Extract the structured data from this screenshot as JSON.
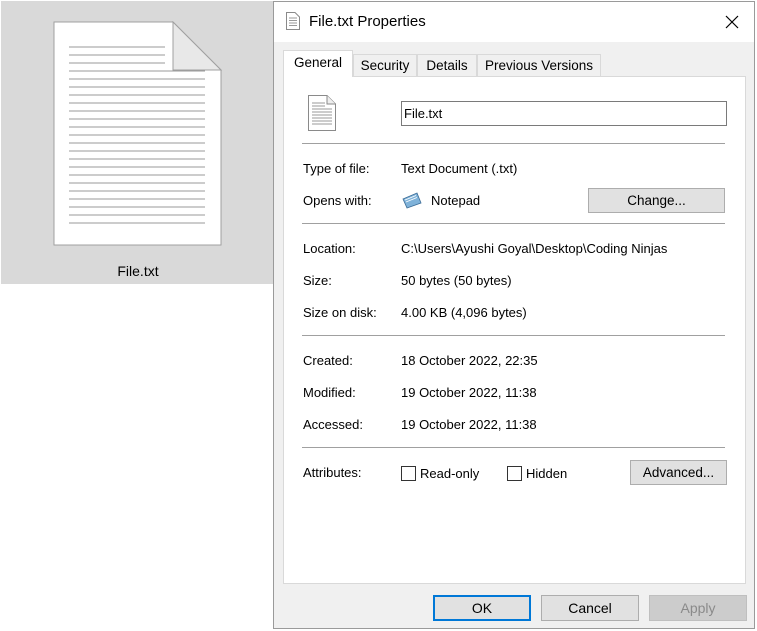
{
  "explorer": {
    "file_name": "File.txt"
  },
  "dialog": {
    "title": "File.txt Properties",
    "tabs": [
      "General",
      "Security",
      "Details",
      "Previous Versions"
    ],
    "file_name_value": "File.txt",
    "type_label": "Type of file:",
    "type_value": "Text Document (.txt)",
    "opens_label": "Opens with:",
    "opens_value": "Notepad",
    "change_button": "Change...",
    "location_label": "Location:",
    "location_value": "C:\\Users\\Ayushi Goyal\\Desktop\\Coding Ninjas",
    "size_label": "Size:",
    "size_value": "50 bytes (50 bytes)",
    "size_on_disk_label": "Size on disk:",
    "size_on_disk_value": "4.00 KB (4,096 bytes)",
    "created_label": "Created:",
    "created_value": "18 October 2022, 22:35",
    "modified_label": "Modified:",
    "modified_value": "19 October 2022, 11:38",
    "accessed_label": "Accessed:",
    "accessed_value": "19 October 2022, 11:38",
    "attributes_label": "Attributes:",
    "readonly_label": "Read-only",
    "hidden_label": "Hidden",
    "advanced_button": "Advanced...",
    "ok_button": "OK",
    "cancel_button": "Cancel",
    "apply_button": "Apply",
    "accent_color": "#0078d7"
  }
}
